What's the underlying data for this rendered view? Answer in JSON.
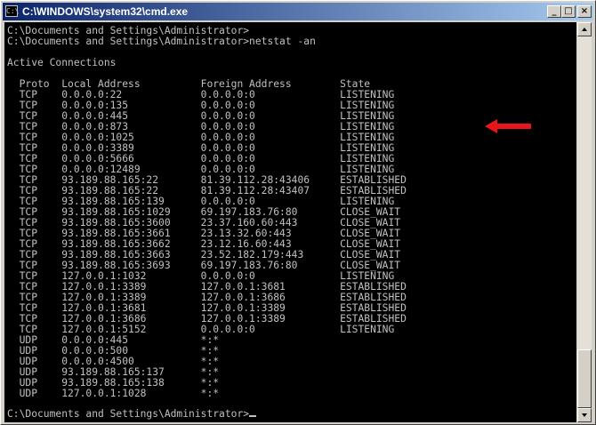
{
  "window": {
    "title": "C:\\WINDOWS\\system32\\cmd.exe"
  },
  "console": {
    "lines": [
      "C:\\Documents and Settings\\Administrator>",
      "C:\\Documents and Settings\\Administrator>netstat -an",
      "",
      "Active Connections",
      "",
      "  Proto  Local Address          Foreign Address        State",
      "  TCP    0.0.0.0:22             0.0.0.0:0              LISTENING",
      "  TCP    0.0.0.0:135            0.0.0.0:0              LISTENING",
      "  TCP    0.0.0.0:445            0.0.0.0:0              LISTENING",
      "  TCP    0.0.0.0:873            0.0.0.0:0              LISTENING",
      "  TCP    0.0.0.0:1025           0.0.0.0:0              LISTENING",
      "  TCP    0.0.0.0:3389           0.0.0.0:0              LISTENING",
      "  TCP    0.0.0.0:5666           0.0.0.0:0              LISTENING",
      "  TCP    0.0.0.0:12489          0.0.0.0:0              LISTENING",
      "  TCP    93.189.88.165:22       81.39.112.28:43406     ESTABLISHED",
      "  TCP    93.189.88.165:22       81.39.112.28:43407     ESTABLISHED",
      "  TCP    93.189.88.165:139      0.0.0.0:0              LISTENING",
      "  TCP    93.189.88.165:1029     69.197.183.76:80       CLOSE_WAIT",
      "  TCP    93.189.88.165:3600     23.37.160.60:443       CLOSE_WAIT",
      "  TCP    93.189.88.165:3661     23.13.32.60:443        CLOSE_WAIT",
      "  TCP    93.189.88.165:3662     23.12.16.60:443        CLOSE_WAIT",
      "  TCP    93.189.88.165:3663     23.52.182.179:443      CLOSE_WAIT",
      "  TCP    93.189.88.165:3693     69.197.183.76:80       CLOSE_WAIT",
      "  TCP    127.0.0.1:1032         0.0.0.0:0              LISTENING",
      "  TCP    127.0.0.1:3389         127.0.0.1:3681         ESTABLISHED",
      "  TCP    127.0.0.1:3389         127.0.0.1:3686         ESTABLISHED",
      "  TCP    127.0.0.1:3681         127.0.0.1:3389         ESTABLISHED",
      "  TCP    127.0.0.1:3686         127.0.0.1:3389         ESTABLISHED",
      "  TCP    127.0.0.1:5152         0.0.0.0:0              LISTENING",
      "  UDP    0.0.0.0:445            *:*",
      "  UDP    0.0.0.0:500            *:*",
      "  UDP    0.0.0.0:4500           *:*",
      "  UDP    93.189.88.165:137      *:*",
      "  UDP    93.189.88.165:138      *:*",
      "  UDP    127.0.0.1:1028         *:*"
    ],
    "prompt": "C:\\Documents and Settings\\Administrator>"
  },
  "annotation": {
    "icon": "red-arrow-left-icon",
    "color": "#e8161b"
  },
  "title_buttons": {
    "minimize": "_",
    "maximize": "□",
    "close": "×"
  }
}
